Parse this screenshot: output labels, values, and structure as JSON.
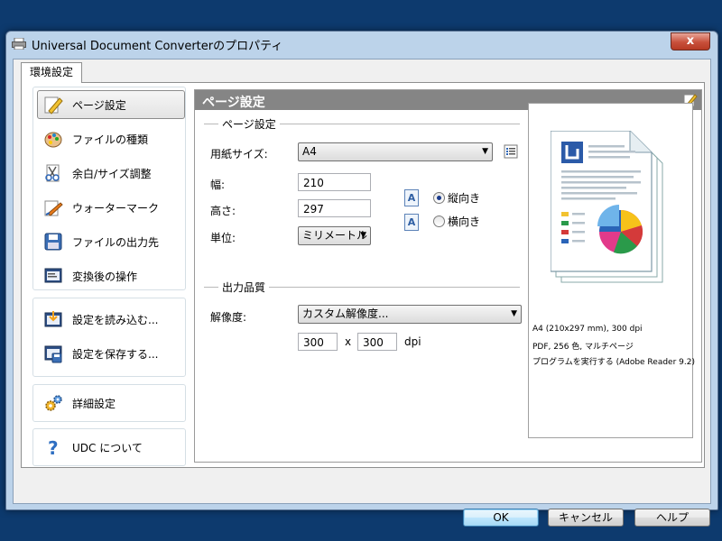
{
  "window": {
    "title": "Universal Document Converterのプロパティ",
    "close": "x"
  },
  "tab": {
    "label": "環境設定"
  },
  "nav": {
    "group1": [
      "ページ設定",
      "ファイルの種類",
      "余白/サイズ調整",
      "ウォーターマーク",
      "ファイルの出力先",
      "変換後の操作"
    ],
    "group2": [
      "設定を読み込む...",
      "設定を保存する..."
    ],
    "group3": [
      "詳細設定"
    ],
    "group4": [
      "UDC について"
    ]
  },
  "content": {
    "header": "ページ設定",
    "page_section": "ページ設定",
    "paper_size_label": "用紙サイズ:",
    "paper_size_value": "A4",
    "width_label": "幅:",
    "width_value": "210",
    "height_label": "高さ:",
    "height_value": "297",
    "unit_label": "単位:",
    "unit_value": "ミリメートル",
    "portrait_label": "縦向き",
    "landscape_label": "横向き",
    "orientation_selected": "縦向き",
    "quality_section": "出力品質",
    "resolution_label": "解像度:",
    "resolution_value": "カスタム解像度...",
    "dpi_x": "300",
    "dpi_sep": "x",
    "dpi_y": "300",
    "dpi_unit": "dpi"
  },
  "preview": {
    "info": [
      "A4 (210x297 mm), 300 dpi",
      "PDF, 256 色, マルチページ",
      "プログラムを実行する (Adobe Reader 9.2)"
    ]
  },
  "buttons": {
    "ok": "OK",
    "cancel": "キャンセル",
    "help": "ヘルプ"
  },
  "colors": {
    "desktop": "#0d3a6e",
    "header_bar": "#858585",
    "selected_item": "#e3e3e3"
  }
}
